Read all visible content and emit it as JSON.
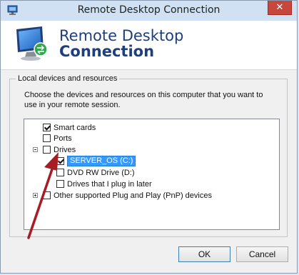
{
  "window": {
    "title": "Remote Desktop Connection",
    "close_symbol": "✕"
  },
  "banner": {
    "line1": "Remote Desktop",
    "line2": "Connection"
  },
  "local_devices": {
    "group_label": "Local devices and resources",
    "description": "Choose the devices and resources on this computer that you want to use in your remote session.",
    "items": [
      {
        "label": "Smart cards",
        "checked": true
      },
      {
        "label": "Ports",
        "checked": false
      },
      {
        "label": "Drives",
        "checked": false,
        "expanded": true
      },
      {
        "label": "SERVER_OS (C:)",
        "checked": true,
        "selected": true
      },
      {
        "label": "DVD RW Drive (D:)",
        "checked": false
      },
      {
        "label": "Drives that I plug in later",
        "checked": false
      },
      {
        "label": "Other supported Plug and Play (PnP) devices",
        "checked": false,
        "expanded": false
      }
    ]
  },
  "buttons": {
    "ok": "OK",
    "cancel": "Cancel"
  },
  "annotation": {
    "arrow_color": "#a81c24"
  }
}
